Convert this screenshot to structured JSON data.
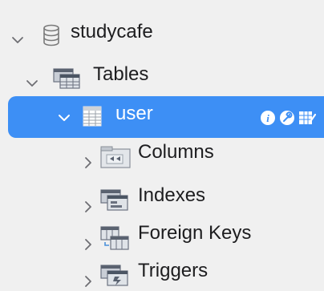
{
  "tree": {
    "database": {
      "label": "studycafe",
      "expanded": true,
      "icon": "database-icon"
    },
    "tables_group": {
      "label": "Tables",
      "expanded": true,
      "icon": "folder-tables-icon"
    },
    "selected_table": {
      "label": "user",
      "expanded": true,
      "icon": "table-grid-icon",
      "actions": [
        "info-icon",
        "wrench-icon",
        "edit-table-icon"
      ]
    },
    "children": [
      {
        "label": "Columns",
        "icon": "columns-folder-icon",
        "expanded": false
      },
      {
        "label": "Indexes",
        "icon": "indexes-folder-icon",
        "expanded": false
      },
      {
        "label": "Foreign Keys",
        "icon": "foreign-keys-icon",
        "expanded": false
      },
      {
        "label": "Triggers",
        "icon": "triggers-folder-icon",
        "expanded": false
      }
    ]
  },
  "colors": {
    "selection": "#3d8ff5",
    "background": "#f0f0f0",
    "text": "#1d1d1f",
    "chevron": "#6e6e73"
  }
}
